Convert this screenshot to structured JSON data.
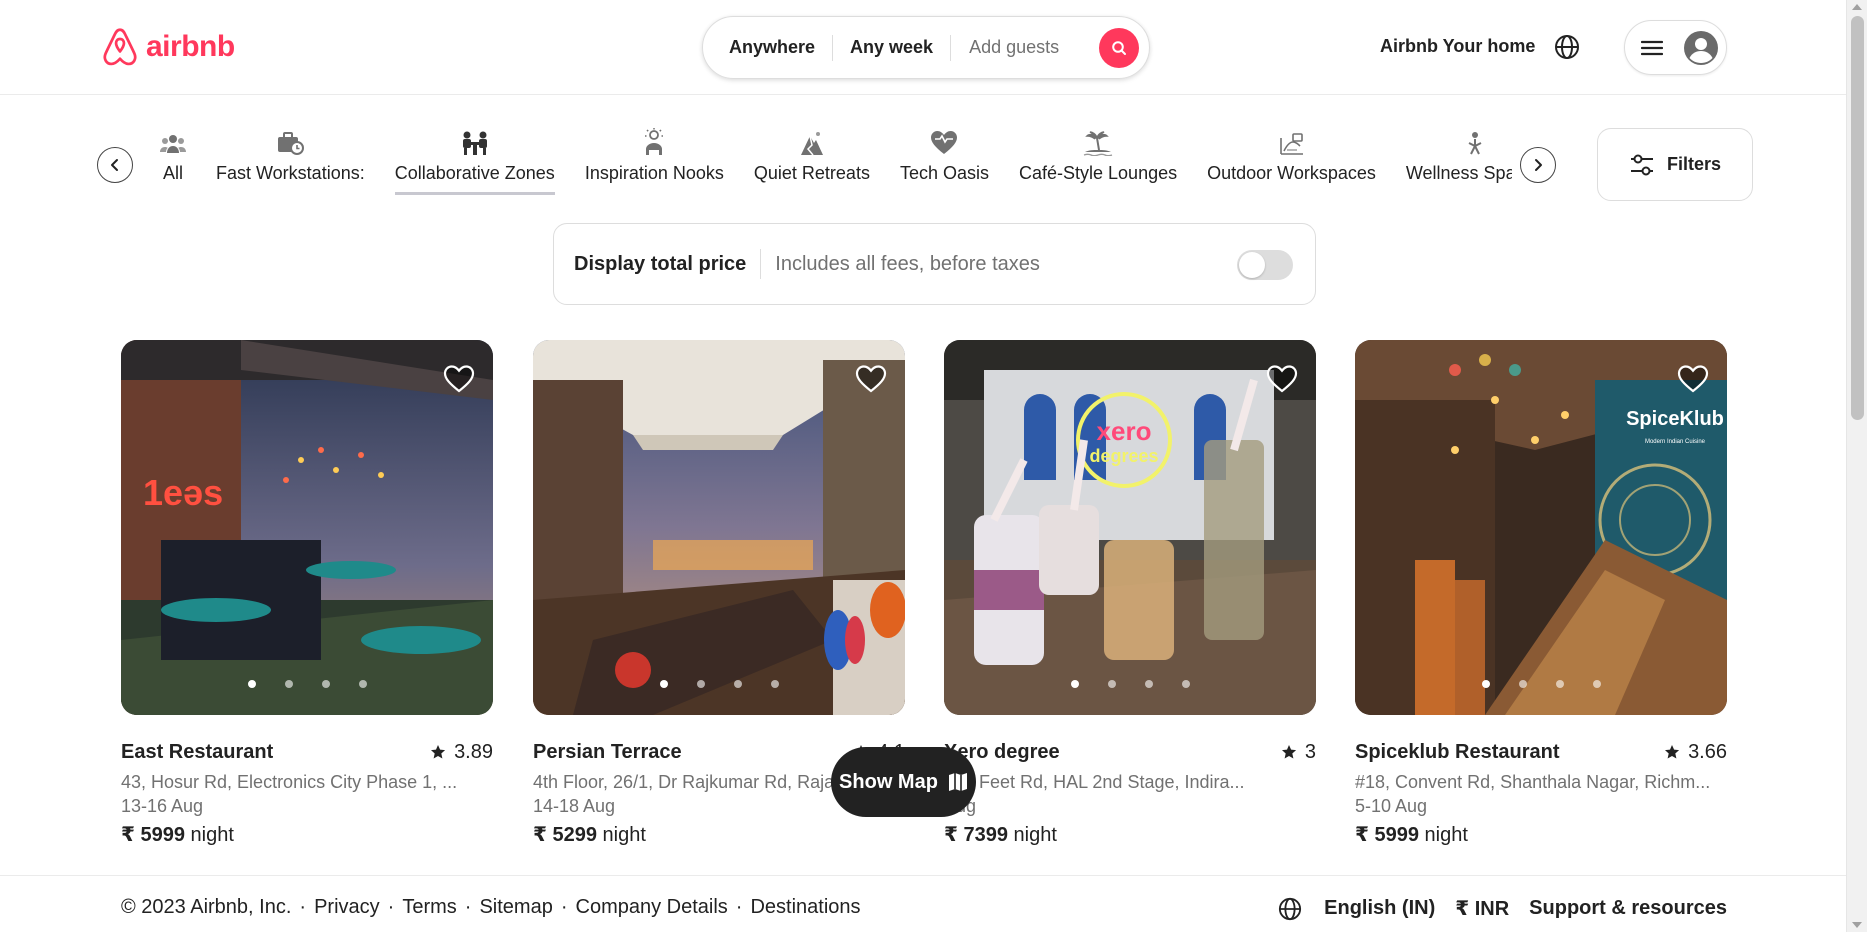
{
  "header": {
    "brand": "airbnb",
    "search": {
      "where": "Anywhere",
      "when": "Any week",
      "guests": "Add guests"
    },
    "host_link": "Airbnb Your home"
  },
  "categories": [
    {
      "label": "All",
      "icon": "people-group-icon"
    },
    {
      "label": "Fast Workstations:",
      "icon": "briefcase-clock-icon"
    },
    {
      "label": "Collaborative Zones",
      "icon": "team-meeting-icon",
      "active": true
    },
    {
      "label": "Inspiration Nooks",
      "icon": "lightbulb-person-icon"
    },
    {
      "label": "Quiet Retreats",
      "icon": "mountain-icon"
    },
    {
      "label": "Tech Oasis",
      "icon": "heart-circuit-icon"
    },
    {
      "label": "Café-Style Lounges",
      "icon": "island-palm-icon"
    },
    {
      "label": "Outdoor Workspaces",
      "icon": "landscape-icon"
    },
    {
      "label": "Wellness Spaces",
      "icon": "wellness-icon"
    }
  ],
  "filters_label": "Filters",
  "total_price": {
    "title": "Display total price",
    "desc": "Includes all fees, before taxes",
    "enabled": false
  },
  "listings": [
    {
      "title": "East Restaurant",
      "rating": "3.89",
      "address": "43, Hosur Rd, Electronics City Phase 1, ...",
      "dates": "13-16 Aug",
      "currency": "₹",
      "price": "5999",
      "unit": "night"
    },
    {
      "title": "Persian Terrace",
      "rating": "4.1",
      "address": "4th Floor, 26/1, Dr Rajkumar Rd, Raja",
      "dates": "14-18 Aug",
      "currency": "₹",
      "price": "5299",
      "unit": "night"
    },
    {
      "title": "Xero degree",
      "rating": "3",
      "address": "100 Feet Rd, HAL 2nd Stage, Indira...",
      "dates": "Aug",
      "currency": "₹",
      "price": "7399",
      "unit": "night"
    },
    {
      "title": "Spiceklub Restaurant",
      "rating": "3.66",
      "address": "#18, Convent Rd, Shanthala Nagar, Richm...",
      "dates": "5-10 Aug",
      "currency": "₹",
      "price": "5999",
      "unit": "night"
    }
  ],
  "photo_text": [
    "1eəs",
    "xero",
    "degrees",
    "SpiceKlub",
    "Modern Indian Cuisine"
  ],
  "show_map": "Show Map",
  "footer": {
    "copyright": "© 2023 Airbnb, Inc.",
    "links": [
      "Privacy",
      "Terms",
      "Sitemap",
      "Company Details",
      "Destinations"
    ],
    "language": "English (IN)",
    "currency": "₹ INR",
    "support": "Support & resources"
  },
  "colors": {
    "brand": "#ff385c",
    "text": "#222222",
    "muted": "#717171",
    "border": "#dddddd"
  }
}
